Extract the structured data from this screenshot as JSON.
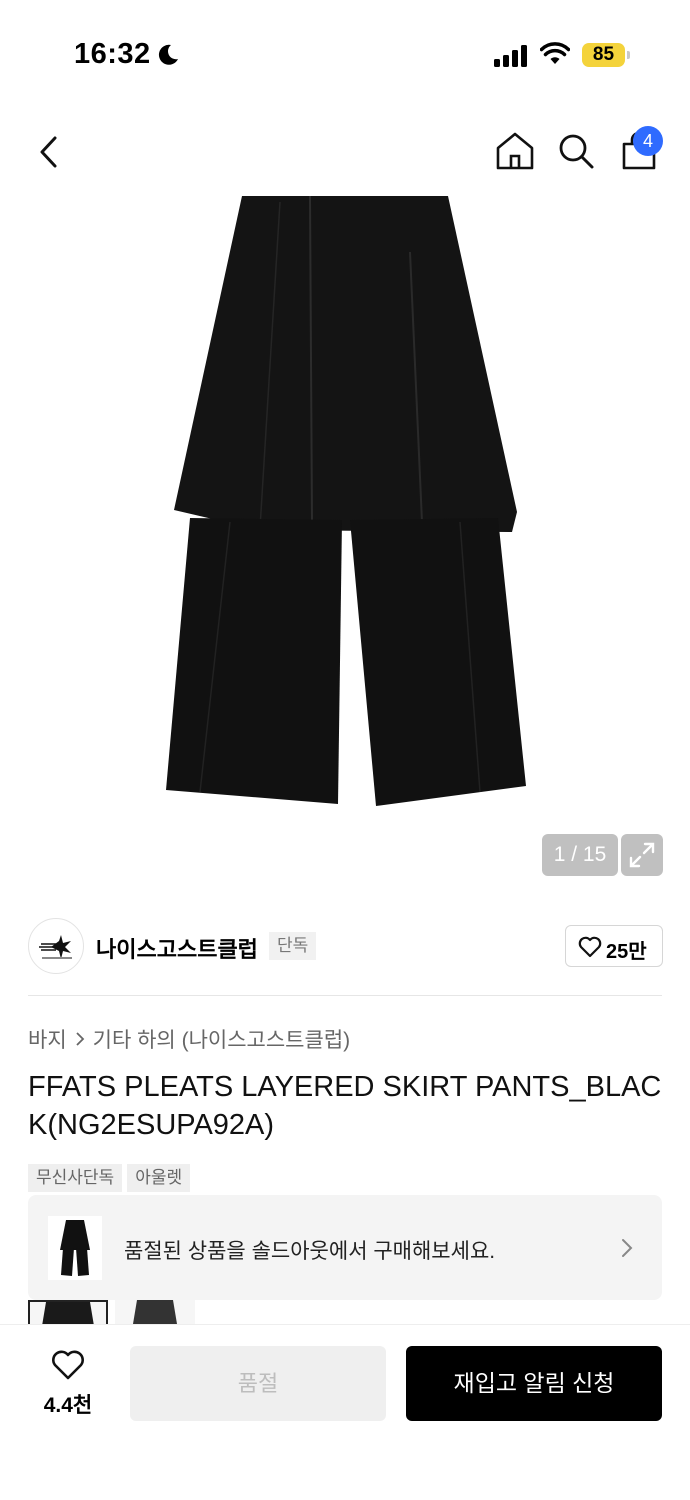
{
  "status_bar": {
    "time": "16:32",
    "battery": "85"
  },
  "header": {
    "cart_count": "4"
  },
  "gallery": {
    "counter": "1 / 15"
  },
  "brand": {
    "name": "나이스고스트클럽",
    "tag": "단독",
    "likes": "25만"
  },
  "breadcrumb": {
    "level1": "바지",
    "level2": "기타 하의 (나이스고스트클럽)"
  },
  "product": {
    "title": "FFATS PLEATS LAYERED SKIRT PANTS_BLACK(NG2ESUPA92A)"
  },
  "tags": [
    "무신사단독",
    "아울렛"
  ],
  "soldout_banner": {
    "text": "품절된 상품을 솔드아웃에서 구매해보세요."
  },
  "bottom_bar": {
    "wish_count": "4.4천",
    "soldout_label": "품절",
    "restock_label": "재입고 알림 신청"
  },
  "colors": {
    "badge": "#2f6bff",
    "battery": "#f4d33b",
    "primary_button": "#000000"
  }
}
